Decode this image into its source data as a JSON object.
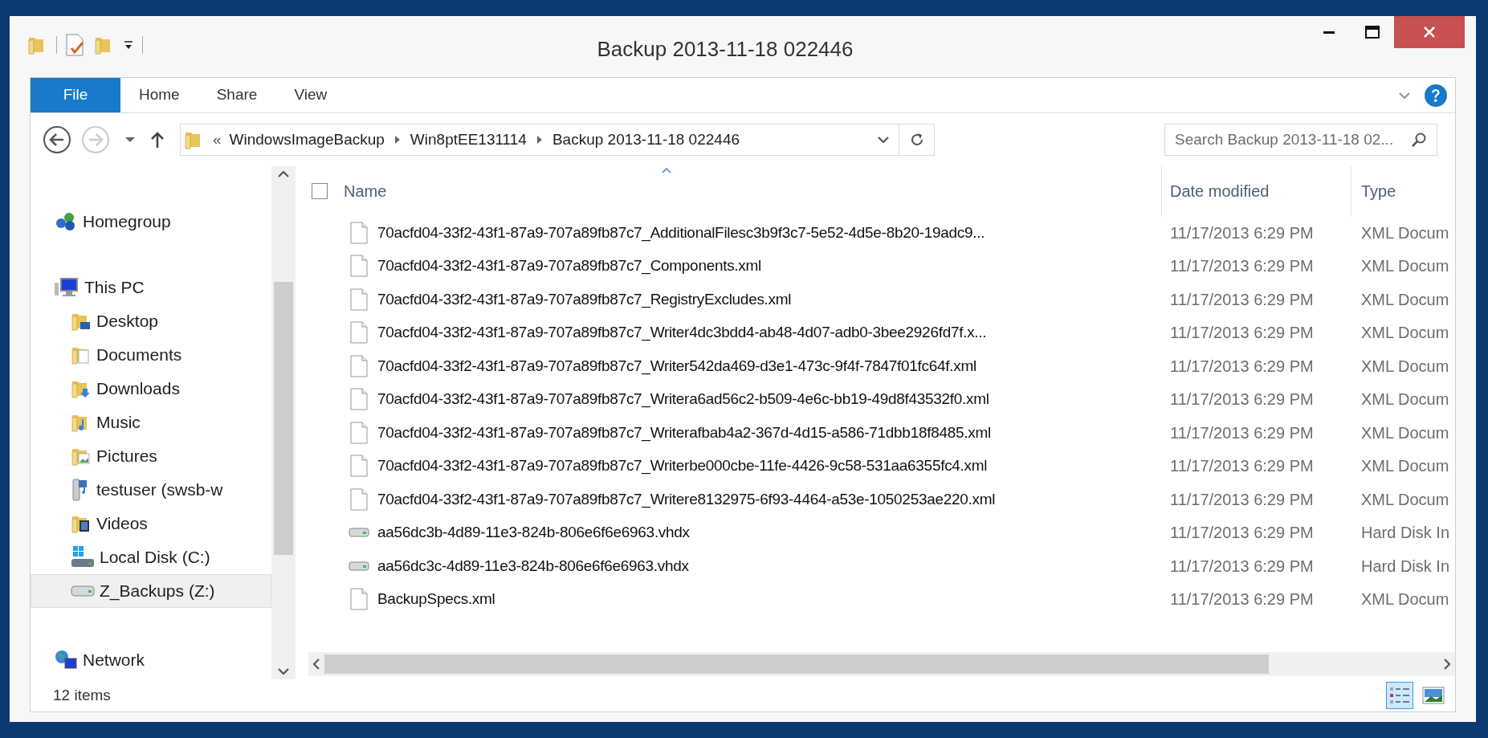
{
  "window": {
    "title": "Backup 2013-11-18 022446"
  },
  "ribbon_tabs": [
    {
      "label": "File",
      "kind": "file_menu"
    },
    {
      "label": "Home",
      "kind": "tab"
    },
    {
      "label": "Share",
      "kind": "tab"
    },
    {
      "label": "View",
      "kind": "tab"
    }
  ],
  "address_bar": {
    "overflow": "«",
    "segments": [
      "WindowsImageBackup",
      "Win8ptEE131114",
      "Backup 2013-11-18 022446"
    ]
  },
  "search": {
    "placeholder": "Search Backup 2013-11-18 02..."
  },
  "sidebar": {
    "items": [
      {
        "label": "Homegroup",
        "kind": "homegroup",
        "selected": false
      },
      {
        "label": "This PC",
        "kind": "computer",
        "selected": false,
        "children": [
          {
            "label": "Desktop",
            "kind": "desktop",
            "selected": false
          },
          {
            "label": "Documents",
            "kind": "documents",
            "selected": false
          },
          {
            "label": "Downloads",
            "kind": "downloads",
            "selected": false
          },
          {
            "label": "Music",
            "kind": "music",
            "selected": false
          },
          {
            "label": "Pictures",
            "kind": "pictures",
            "selected": false
          },
          {
            "label": "testuser (swsb-w",
            "kind": "user",
            "selected": false
          },
          {
            "label": "Videos",
            "kind": "videos",
            "selected": false
          },
          {
            "label": "Local Disk (C:)",
            "kind": "system_drive",
            "selected": false
          },
          {
            "label": "Z_Backups (Z:)",
            "kind": "drive",
            "selected": true
          }
        ]
      },
      {
        "label": "Network",
        "kind": "network",
        "selected": false
      }
    ]
  },
  "file_list": {
    "select_all": {
      "checked": false
    },
    "columns": [
      "Name",
      "Date modified",
      "Type"
    ],
    "rows": [
      {
        "name": "70acfd04-33f2-43f1-87a9-707a89fb87c7_AdditionalFilesc3b9f3c7-5e52-4d5e-8b20-19adc9...",
        "date": "11/17/2013 6:29 PM",
        "type": "XML Docum",
        "kind": "document"
      },
      {
        "name": "70acfd04-33f2-43f1-87a9-707a89fb87c7_Components.xml",
        "date": "11/17/2013 6:29 PM",
        "type": "XML Docum",
        "kind": "document"
      },
      {
        "name": "70acfd04-33f2-43f1-87a9-707a89fb87c7_RegistryExcludes.xml",
        "date": "11/17/2013 6:29 PM",
        "type": "XML Docum",
        "kind": "document"
      },
      {
        "name": "70acfd04-33f2-43f1-87a9-707a89fb87c7_Writer4dc3bdd4-ab48-4d07-adb0-3bee2926fd7f.x...",
        "date": "11/17/2013 6:29 PM",
        "type": "XML Docum",
        "kind": "document"
      },
      {
        "name": "70acfd04-33f2-43f1-87a9-707a89fb87c7_Writer542da469-d3e1-473c-9f4f-7847f01fc64f.xml",
        "date": "11/17/2013 6:29 PM",
        "type": "XML Docum",
        "kind": "document"
      },
      {
        "name": "70acfd04-33f2-43f1-87a9-707a89fb87c7_Writera6ad56c2-b509-4e6c-bb19-49d8f43532f0.xml",
        "date": "11/17/2013 6:29 PM",
        "type": "XML Docum",
        "kind": "document"
      },
      {
        "name": "70acfd04-33f2-43f1-87a9-707a89fb87c7_Writerafbab4a2-367d-4d15-a586-71dbb18f8485.xml",
        "date": "11/17/2013 6:29 PM",
        "type": "XML Docum",
        "kind": "document"
      },
      {
        "name": "70acfd04-33f2-43f1-87a9-707a89fb87c7_Writerbe000cbe-11fe-4426-9c58-531aa6355fc4.xml",
        "date": "11/17/2013 6:29 PM",
        "type": "XML Docum",
        "kind": "document"
      },
      {
        "name": "70acfd04-33f2-43f1-87a9-707a89fb87c7_Writere8132975-6f93-4464-a53e-1050253ae220.xml",
        "date": "11/17/2013 6:29 PM",
        "type": "XML Docum",
        "kind": "document"
      },
      {
        "name": "aa56dc3b-4d89-11e3-824b-806e6f6e6963.vhdx",
        "date": "11/17/2013 6:29 PM",
        "type": "Hard Disk In",
        "kind": "disk_image"
      },
      {
        "name": "aa56dc3c-4d89-11e3-824b-806e6f6e6963.vhdx",
        "date": "11/17/2013 6:29 PM",
        "type": "Hard Disk In",
        "kind": "disk_image"
      },
      {
        "name": "BackupSpecs.xml",
        "date": "11/17/2013 6:29 PM",
        "type": "XML Docum",
        "kind": "document"
      }
    ]
  },
  "status_bar": {
    "item_count": "12 items"
  },
  "view_buttons": [
    {
      "kind": "details",
      "selected": true
    },
    {
      "kind": "large_icons",
      "selected": false
    }
  ]
}
